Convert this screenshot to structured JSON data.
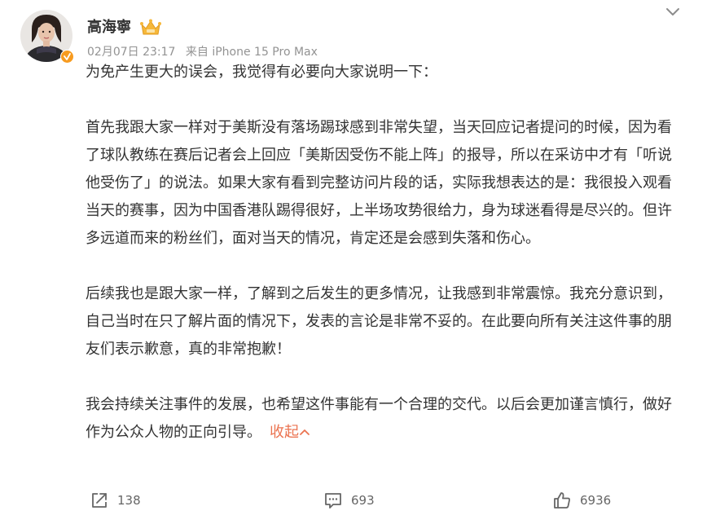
{
  "post": {
    "author": "高海寧",
    "timestamp": "02月07日 23:17",
    "source": "来自 iPhone 15 Pro Max",
    "paragraphs": [
      "为免产生更大的误会，我觉得有必要向大家说明一下：",
      "首先我跟大家一样对于美斯没有落场踢球感到非常失望，当天回应记者提问的时候，因为看了球队教练在赛后记者会上回应「美斯因受伤不能上阵」的报导，所以在采访中才有「听说他受伤了」的说法。如果大家有看到完整访问片段的话，实际我想表达的是：我很投入观看当天的赛事，因为中国香港队踢得很好，上半场攻势很给力，身为球迷看得是尽兴的。但许多远道而来的粉丝们，面对当天的情况，肯定还是会感到失落和伤心。",
      "后续我也是跟大家一样，了解到之后发生的更多情况，让我感到非常震惊。我充分意识到，自己当时在只了解片面的情况下，发表的言论是非常不妥的。在此要向所有关注这件事的朋友们表示歉意，真的非常抱歉！",
      "我会持续关注事件的发展，也希望这件事能有一个合理的交代。以后会更加谨言慎行，做好作为公众人物的正向引导。"
    ],
    "collapse_label": "收起"
  },
  "actions": {
    "repost_count": "138",
    "comment_count": "693",
    "like_count": "6936"
  },
  "icons": {
    "menu": "chevron-down-icon",
    "verified": "verified-badge-icon",
    "vip": "crown-icon",
    "repost": "share-icon",
    "comment": "comment-icon",
    "like": "thumbs-up-icon"
  },
  "colors": {
    "accent": "#eb7350",
    "verified": "#f79b1f",
    "meta_text": "#939393"
  }
}
